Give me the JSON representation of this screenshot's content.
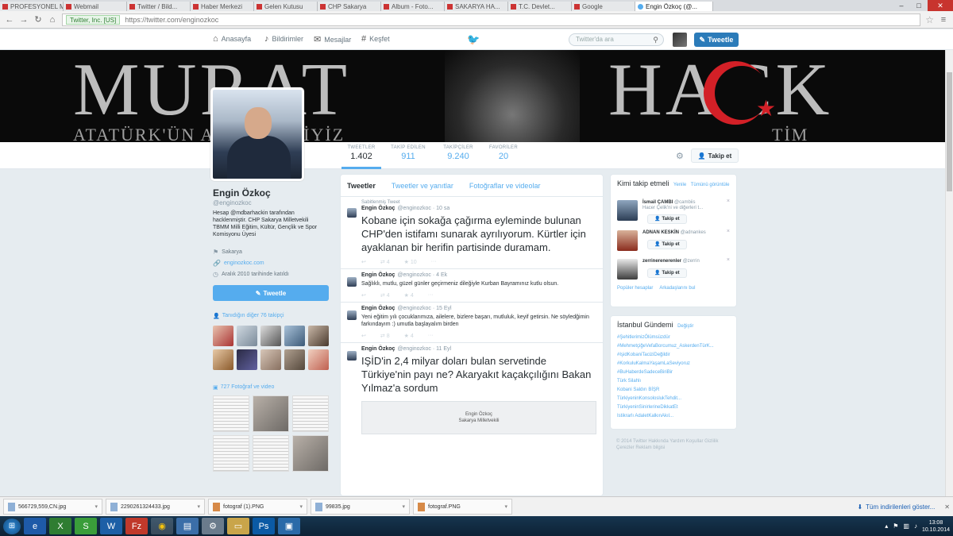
{
  "browser": {
    "tabs": [
      {
        "label": "PROFESYONEL MÜH..."
      },
      {
        "label": "Webmail"
      },
      {
        "label": "Twitter / Bild..."
      },
      {
        "label": "Haber Merkezi"
      },
      {
        "label": "Gelen Kutusu"
      },
      {
        "label": "CHP Sakarya"
      },
      {
        "label": "Album - Foto..."
      },
      {
        "label": "SAKARYA HA..."
      },
      {
        "label": "T.C. Devlet..."
      },
      {
        "label": "Google"
      },
      {
        "label": "Engin Özkoç (@..."
      }
    ],
    "active_tab": "Engin Özkoç (@...",
    "secure_label": "Twitter, Inc. [US]",
    "url": "https://twitter.com/enginozkoc"
  },
  "topnav": {
    "home": "Anasayfa",
    "notifications": "Bildirimler",
    "messages": "Mesajlar",
    "discover": "Keşfet",
    "search_placeholder": "Twitter'da ara",
    "tweet_button": "Tweetle"
  },
  "banner": {
    "big_left": "MURAT",
    "big_right": "HACK",
    "sub_left": "ATATÜRK'ÜN ASKERLERİYİZ",
    "sub_right": "TİM"
  },
  "profile": {
    "name": "Engin Özkoç",
    "handle": "@enginozkoc",
    "bio": "Hesap @mdbarhackin tarafından hacklenmiştir. CHP Sakarya Milletvekili TBMM Milli Eğitim, Kültür, Gençlik ve Spor Komisyonu Üyesi",
    "location": "Sakarya",
    "website": "enginozkoc.com",
    "joined": "Aralık 2010 tarihinde katıldı",
    "tweet_button": "Tweetle",
    "followers_you_know": "Tanıdığın diğer 76 takipçi",
    "photos_videos": "727 Fotoğraf ve video"
  },
  "stats": [
    {
      "label": "TWEETLER",
      "value": "1.402"
    },
    {
      "label": "TAKİP EDİLEN",
      "value": "911"
    },
    {
      "label": "TAKİPÇİLER",
      "value": "9.240"
    },
    {
      "label": "FAVORİLER",
      "value": "20"
    }
  ],
  "follow_button": "Takip et",
  "timeline": {
    "tabs": [
      "Tweetler",
      "Tweetler ve yanıtlar",
      "Fotoğraflar ve videolar"
    ],
    "tweets": [
      {
        "retweet_note": "Sabitlenmiş Tweet",
        "name": "Engin Özkoç",
        "handle": "@enginozkoc · 10 sa",
        "text": "Kobane için sokağa çağırma eyleminde bulunan CHP'den istifamı sunarak ayrılıyorum. Kürtler için ayaklanan bir herifin partisinde duramam.",
        "retweets": "4",
        "favorites": "10"
      },
      {
        "name": "Engin Özkoç",
        "handle": "@enginozkoc · 4 Ek",
        "text": "Sağlıklı, mutlu, güzel günler geçirmeniz dileğiyle Kurban Bayramınız kutlu olsun.",
        "retweets": "4",
        "favorites": "4"
      },
      {
        "name": "Engin Özkoç",
        "handle": "@enginozkoc · 15 Eyl",
        "text": "Yeni eğitim yılı çocuklarımıza, ailelere, bizlere başarı, mutluluk, keyif getirsin. Ne söyledğimin farkındayım :) umutla başlayalım birden",
        "retweets": "8",
        "favorites": "4"
      },
      {
        "name": "Engin Özkoç",
        "handle": "@enginozkoc · 11 Eyl",
        "text": "IŞİD'in 2,4 milyar doları bulan servetinde Türkiye'nin payı ne? Akaryakıt kaçakçılığını Bakan Yılmaz'a sordum",
        "media_line1": "Engin Özkoç",
        "media_line2": "Sakarya Milletvekili"
      }
    ]
  },
  "who_to_follow": {
    "title": "Kimi takip etmeli",
    "refresh": "Yenile",
    "view_all": "Tümünü görüntüle",
    "users": [
      {
        "name": "İsmail ÇAMBI",
        "handle": "@cambiis",
        "extra": "Hacer Çelik'ni ve diğerleri t...",
        "button": "Takip et"
      },
      {
        "name": "ADNAN KESKİN",
        "handle": "@adnankes",
        "button": "Takip et"
      },
      {
        "name": "zerrinerenerenler",
        "handle": "@zerrin",
        "button": "Takip et"
      }
    ],
    "popular": "Popüler hesaplar",
    "find_friends": "Arkadaşlarını bul"
  },
  "trends": {
    "title": "İstanbul Gündemi",
    "change": "Değiştir",
    "items": [
      "#ŞehitlerimizÖlümsüzdür",
      "#MehmetçiğeVefaBorcumuz_AskerdenTürK...",
      "#IşidKobaniTaciziDeğildir",
      "#KorkuluKalmaYaşamLaSeviyoruz",
      "#BuHaberdeSadeceBiriBir",
      "Türk Silahlı",
      "Kobani Saldırı BİŞR",
      "TürkiyeninKonsoloslukTehdit...",
      "TürkiyeninSinirlerineDikkatEt",
      "Istikrarlı AdaletKalkınAkıl..."
    ]
  },
  "footer_text": "© 2014 Twitter Hakkında Yardım Koşullar Gizlilik Çerezler Reklam bilgisi",
  "downloads": {
    "items": [
      {
        "name": "566729,559,CN.jpg",
        "type": "jpg"
      },
      {
        "name": "2290261324433.jpg",
        "type": "jpg"
      },
      {
        "name": "fotograf (1).PNG",
        "type": "png"
      },
      {
        "name": "99835.jpg",
        "type": "jpg"
      },
      {
        "name": "fotograf.PNG",
        "type": "png"
      }
    ],
    "show_all": "Tüm indirilenleri göster..."
  },
  "taskbar": {
    "time": "13:08",
    "date": "10.10.2014"
  },
  "colors": {
    "twitter_blue": "#55acee",
    "tweet_button": "#2b7bb9",
    "banner_red": "#d32027"
  }
}
